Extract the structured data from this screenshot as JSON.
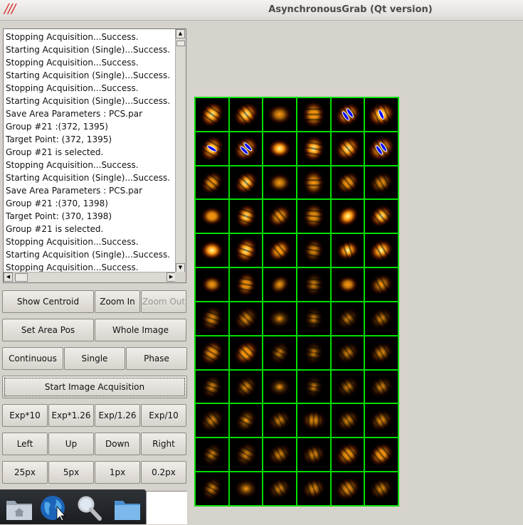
{
  "window": {
    "title": "AsynchronousGrab (Qt version)",
    "logo_text": "///"
  },
  "log": {
    "lines": [
      "Stopping Acquisition...Success.",
      "Starting Acquisition (Single)...Success.",
      "Stopping Acquisition...Success.",
      "Starting Acquisition (Single)...Success.",
      "Stopping Acquisition...Success.",
      "Starting Acquisition (Single)...Success.",
      "Save Area Parameters : PCS.par",
      "Group #21 :(372, 1395)",
      "Target Point: (372, 1395)",
      "Group #21 is selected.",
      "Stopping Acquisition...Success.",
      "Starting Acquisition (Single)...Success.",
      "Save Area Parameters : PCS.par",
      "Group #21 :(370, 1398)",
      "Target Point: (370, 1398)",
      "Group #21 is selected.",
      "Stopping Acquisition...Success.",
      "Starting Acquisition (Single)...Success.",
      "Stopping Acquisition...Success."
    ]
  },
  "buttons": {
    "show_centroid": "Show Centroid",
    "zoom_in": "Zoom In",
    "zoom_out": "Zoom Out",
    "set_area_pos": "Set Area Pos",
    "whole_image": "Whole Image",
    "continuous": "Continuous",
    "single": "Single",
    "phase": "Phase",
    "start_acquisition": "Start Image Acquisition",
    "exp_x10": "Exp*10",
    "exp_x126": "Exp*1.26",
    "exp_d126": "Exp/1.26",
    "exp_d10": "Exp/10",
    "left": "Left",
    "up": "Up",
    "down": "Down",
    "right": "Right",
    "px25": "25px",
    "px5": "5px",
    "px1": "1px",
    "px02": "0.2px"
  },
  "dock": {
    "icons": [
      "home-folder-icon",
      "web-browser-icon",
      "search-icon",
      "folder-icon"
    ]
  },
  "spot_grid": {
    "rows": 12,
    "cols": 6,
    "colors": {
      "grid_line": "#00e000",
      "centroid": "#0000ff",
      "spot_hot": "#ffffa0",
      "spot_mid": "#ff9a10",
      "spot_low": "#5a1500"
    },
    "cells": [
      {
        "i": 1.0,
        "a": -55,
        "s": 0.55,
        "f": 3
      },
      {
        "i": 1.0,
        "a": -40,
        "s": 0.55,
        "f": 3
      },
      {
        "i": 0.55,
        "a": 0,
        "s": 0.5,
        "f": 0
      },
      {
        "i": 0.75,
        "a": -90,
        "s": 0.6,
        "f": 3
      },
      {
        "i": 1.0,
        "a": -35,
        "s": 0.55,
        "f": 3,
        "c": 2
      },
      {
        "i": 1.0,
        "a": -25,
        "s": 0.6,
        "f": 3,
        "c": 1
      },
      {
        "i": 1.0,
        "a": -60,
        "s": 0.55,
        "f": 3,
        "c": 1
      },
      {
        "i": 1.0,
        "a": -45,
        "s": 0.55,
        "f": 3,
        "c": 2
      },
      {
        "i": 0.9,
        "a": 0,
        "s": 0.45,
        "f": 0
      },
      {
        "i": 0.9,
        "a": -80,
        "s": 0.55,
        "f": 3
      },
      {
        "i": 1.0,
        "a": -40,
        "s": 0.55,
        "f": 3
      },
      {
        "i": 1.0,
        "a": -35,
        "s": 0.6,
        "f": 3,
        "c": 2
      },
      {
        "i": 0.7,
        "a": -50,
        "s": 0.5,
        "f": 3
      },
      {
        "i": 0.9,
        "a": -45,
        "s": 0.5,
        "f": 3
      },
      {
        "i": 0.55,
        "a": 0,
        "s": 0.45,
        "f": 0
      },
      {
        "i": 0.65,
        "a": -90,
        "s": 0.55,
        "f": 2
      },
      {
        "i": 0.7,
        "a": -40,
        "s": 0.5,
        "f": 3
      },
      {
        "i": 0.55,
        "a": -30,
        "s": 0.5,
        "f": 3
      },
      {
        "i": 0.75,
        "a": 0,
        "s": 0.45,
        "f": 0
      },
      {
        "i": 0.85,
        "a": -70,
        "s": 0.5,
        "f": 3
      },
      {
        "i": 0.7,
        "a": -40,
        "s": 0.5,
        "f": 2
      },
      {
        "i": 0.65,
        "a": -85,
        "s": 0.55,
        "f": 3
      },
      {
        "i": 1.0,
        "a": -40,
        "s": 0.45,
        "f": 0
      },
      {
        "i": 0.85,
        "a": -40,
        "s": 0.5,
        "f": 3
      },
      {
        "i": 1.0,
        "a": 0,
        "s": 0.45,
        "f": 0
      },
      {
        "i": 0.9,
        "a": -70,
        "s": 0.55,
        "f": 3
      },
      {
        "i": 0.8,
        "a": -40,
        "s": 0.5,
        "f": 2
      },
      {
        "i": 0.5,
        "a": -80,
        "s": 0.5,
        "f": 3
      },
      {
        "i": 0.9,
        "a": -20,
        "s": 0.45,
        "f": 2
      },
      {
        "i": 0.95,
        "a": -30,
        "s": 0.5,
        "f": 2
      },
      {
        "i": 0.6,
        "a": 0,
        "s": 0.4,
        "f": 0
      },
      {
        "i": 0.7,
        "a": -80,
        "s": 0.5,
        "f": 3
      },
      {
        "i": 0.5,
        "a": -40,
        "s": 0.4,
        "f": 0
      },
      {
        "i": 0.35,
        "a": -85,
        "s": 0.5,
        "f": 3
      },
      {
        "i": 0.65,
        "a": 0,
        "s": 0.4,
        "f": 0
      },
      {
        "i": 0.55,
        "a": -30,
        "s": 0.5,
        "f": 2
      },
      {
        "i": 0.45,
        "a": -70,
        "s": 0.55,
        "f": 3
      },
      {
        "i": 0.45,
        "a": -45,
        "s": 0.55,
        "f": 3
      },
      {
        "i": 0.25,
        "a": 0,
        "s": 0.5,
        "f": 0
      },
      {
        "i": 0.25,
        "a": -85,
        "s": 0.5,
        "f": 3
      },
      {
        "i": 0.3,
        "a": -40,
        "s": 0.5,
        "f": 3
      },
      {
        "i": 0.35,
        "a": -30,
        "s": 0.5,
        "f": 3
      },
      {
        "i": 0.65,
        "a": -60,
        "s": 0.55,
        "f": 3
      },
      {
        "i": 0.8,
        "a": -45,
        "s": 0.55,
        "f": 3
      },
      {
        "i": 0.3,
        "a": -60,
        "s": 0.5,
        "f": 3
      },
      {
        "i": 0.25,
        "a": -80,
        "s": 0.5,
        "f": 3
      },
      {
        "i": 0.35,
        "a": -35,
        "s": 0.5,
        "f": 3
      },
      {
        "i": 0.45,
        "a": -30,
        "s": 0.5,
        "f": 3
      },
      {
        "i": 0.35,
        "a": -70,
        "s": 0.5,
        "f": 3
      },
      {
        "i": 0.4,
        "a": -45,
        "s": 0.5,
        "f": 3
      },
      {
        "i": 0.2,
        "a": 0,
        "s": 0.5,
        "f": 0
      },
      {
        "i": 0.2,
        "a": -80,
        "s": 0.5,
        "f": 3
      },
      {
        "i": 0.3,
        "a": -35,
        "s": 0.5,
        "f": 3
      },
      {
        "i": 0.35,
        "a": -30,
        "s": 0.5,
        "f": 3
      },
      {
        "i": 0.35,
        "a": -40,
        "s": 0.55,
        "f": 3
      },
      {
        "i": 0.35,
        "a": -60,
        "s": 0.5,
        "f": 2
      },
      {
        "i": 0.35,
        "a": -30,
        "s": 0.5,
        "f": 3
      },
      {
        "i": 0.5,
        "a": 0,
        "s": 0.5,
        "f": 3
      },
      {
        "i": 0.4,
        "a": -35,
        "s": 0.5,
        "f": 3
      },
      {
        "i": 0.45,
        "a": -30,
        "s": 0.5,
        "f": 3
      },
      {
        "i": 0.3,
        "a": -60,
        "s": 0.5,
        "f": 3
      },
      {
        "i": 0.35,
        "a": -60,
        "s": 0.55,
        "f": 3
      },
      {
        "i": 0.4,
        "a": -30,
        "s": 0.5,
        "f": 3
      },
      {
        "i": 0.4,
        "a": -20,
        "s": 0.5,
        "f": 3
      },
      {
        "i": 0.7,
        "a": -40,
        "s": 0.55,
        "f": 3
      },
      {
        "i": 0.75,
        "a": -40,
        "s": 0.55,
        "f": 3
      },
      {
        "i": 0.35,
        "a": -60,
        "s": 0.5,
        "f": 3
      },
      {
        "i": 0.3,
        "a": 0,
        "s": 0.5,
        "f": 0
      },
      {
        "i": 0.35,
        "a": -30,
        "s": 0.5,
        "f": 3
      },
      {
        "i": 0.45,
        "a": -20,
        "s": 0.5,
        "f": 3
      },
      {
        "i": 0.55,
        "a": -35,
        "s": 0.55,
        "f": 3
      },
      {
        "i": 0.4,
        "a": -30,
        "s": 0.5,
        "f": 3
      }
    ]
  }
}
